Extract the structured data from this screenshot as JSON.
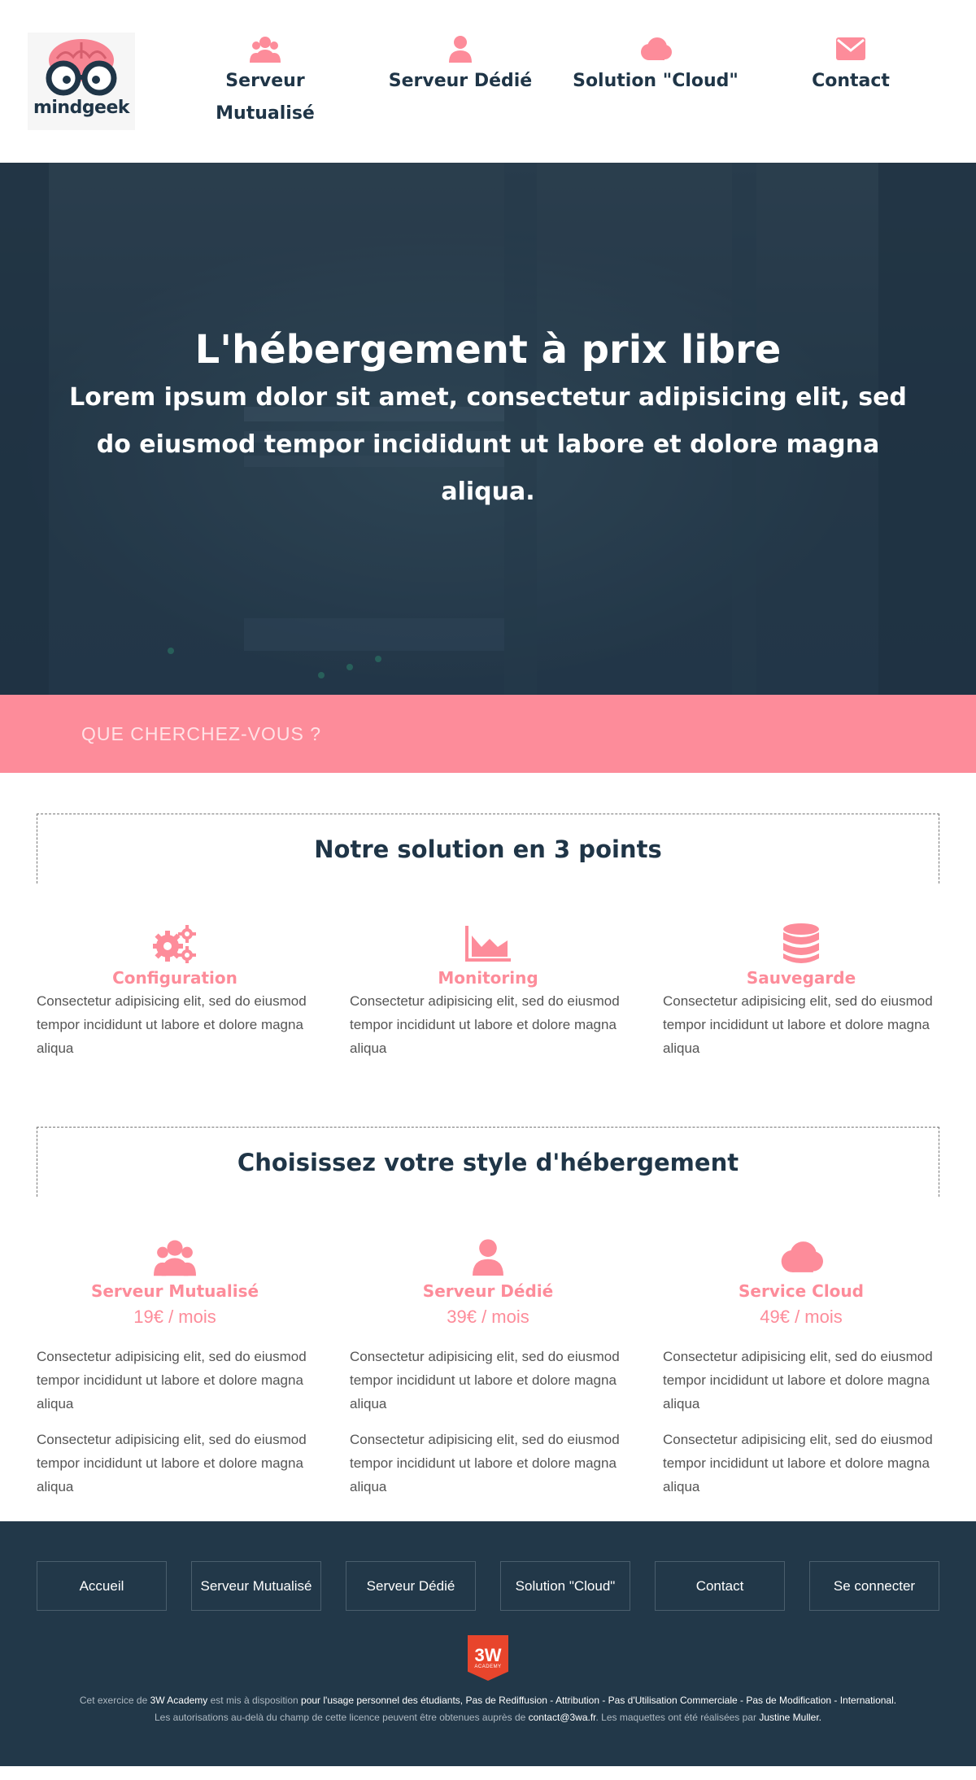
{
  "header": {
    "logo_text": "mindgeek",
    "nav": [
      {
        "label_line1": "Serveur",
        "label_line2": "Mutualisé",
        "icon": "users-icon"
      },
      {
        "label_line1": "Serveur Dédié",
        "label_line2": "",
        "icon": "user-icon"
      },
      {
        "label_line1": "Solution \"Cloud\"",
        "label_line2": "",
        "icon": "cloud-icon"
      },
      {
        "label_line1": "Contact",
        "label_line2": "",
        "icon": "envelope-icon"
      }
    ]
  },
  "hero": {
    "title": "L'hébergement à prix libre",
    "subtitle": "Lorem ipsum dolor sit amet, consectetur adipisicing elit, sed do eiusmod tempor incididunt ut labore et dolore magna aliqua."
  },
  "search": {
    "placeholder": "QUE CHERCHEZ-VOUS ?"
  },
  "points": {
    "title": "Notre solution en 3 points",
    "items": [
      {
        "title": "Configuration",
        "icon": "gears-icon",
        "text": "Consectetur adipisicing elit, sed do eiusmod tempor incididunt ut labore et dolore magna aliqua"
      },
      {
        "title": "Monitoring",
        "icon": "area-chart-icon",
        "text": "Consectetur adipisicing elit, sed do eiusmod tempor incididunt ut labore et dolore magna aliqua"
      },
      {
        "title": "Sauvegarde",
        "icon": "database-icon",
        "text": "Consectetur adipisicing elit, sed do eiusmod tempor incididunt ut labore et dolore magna aliqua"
      }
    ]
  },
  "plans": {
    "title": "Choisissez votre style d'hébergement",
    "items": [
      {
        "title": "Serveur Mutualisé",
        "price": "19€ / mois",
        "icon": "users-icon",
        "text1": "Consectetur adipisicing elit, sed do eiusmod tempor incididunt ut labore et dolore magna aliqua",
        "text2": "Consectetur adipisicing elit, sed do eiusmod tempor incididunt ut labore et dolore magna aliqua"
      },
      {
        "title": "Serveur Dédié",
        "price": "39€ / mois",
        "icon": "user-icon",
        "text1": "Consectetur adipisicing elit, sed do eiusmod tempor incididunt ut labore et dolore magna aliqua",
        "text2": "Consectetur adipisicing elit, sed do eiusmod tempor incididunt ut labore et dolore magna aliqua"
      },
      {
        "title": "Service Cloud",
        "price": "49€ / mois",
        "icon": "cloud-icon",
        "text1": "Consectetur adipisicing elit, sed do eiusmod tempor incididunt ut labore et dolore magna aliqua",
        "text2": "Consectetur adipisicing elit, sed do eiusmod tempor incididunt ut labore et dolore magna aliqua"
      }
    ]
  },
  "footer": {
    "nav": [
      "Accueil",
      "Serveur Mutualisé",
      "Serveur Dédié",
      "Solution \"Cloud\"",
      "Contact",
      "Se connecter"
    ],
    "badge_main": "3W",
    "badge_sub": "ACADEMY",
    "license_line1_a": "Cet exercice de ",
    "license_line1_b": "3W Academy",
    "license_line1_c": " est mis à disposition ",
    "license_line1_d": "pour l'usage personnel des étudiants, Pas de Rediffusion - Attribution - Pas d'Utilisation Commerciale - Pas de Modification - International.",
    "license_line2_a": "Les autorisations au-delà du champ de cette licence peuvent être obtenues auprès de ",
    "license_line2_b": "contact@3wa.fr",
    "license_line2_c": ". Les maquettes ont été réalisées par ",
    "license_line2_d": "Justine Muller."
  },
  "colors": {
    "accent": "#fd8c9a",
    "navy": "#1f3547",
    "footer_bg": "#223849",
    "badge": "#e8452c"
  }
}
